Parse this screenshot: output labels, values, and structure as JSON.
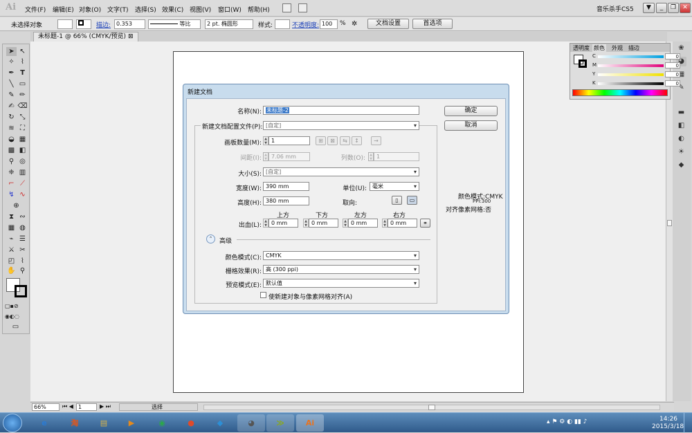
{
  "app": {
    "logo": "Ai",
    "menus": [
      "文件(F)",
      "编辑(E)",
      "对象(O)",
      "文字(T)",
      "选择(S)",
      "效果(C)",
      "视图(V)",
      "窗口(W)",
      "帮助(H)"
    ],
    "brand": "音乐杀手CS5",
    "window_buttons": [
      "▼",
      "_",
      "❐",
      "✕"
    ]
  },
  "control_bar": {
    "selection": "未选择对象",
    "stroke_label": "描边:",
    "stroke_value": "0.353",
    "stroke_style": "等比",
    "brush": "2 pt. 椭圆形",
    "style_label": "样式:",
    "opacity_label": "不透明度:",
    "opacity_value": "100",
    "opacity_unit": "%",
    "doc_setup": "文档设置",
    "preferences": "首选项"
  },
  "document_tab": {
    "label": "未标题-1 @ 66% (CMYK/预览)",
    "close": "⊠"
  },
  "color_panel": {
    "tabs": [
      "透明度",
      "颜色",
      "外观",
      "描边"
    ],
    "channels": [
      {
        "name": "C",
        "value": "0",
        "color": "#00a0e0"
      },
      {
        "name": "M",
        "value": "0",
        "color": "#e0007a"
      },
      {
        "name": "Y",
        "value": "0",
        "color": "#f0e000"
      },
      {
        "name": "K",
        "value": "0",
        "color": "#000000"
      }
    ],
    "unit": "%"
  },
  "dialog": {
    "title": "新建文档",
    "name_label": "名称(N):",
    "name_value": "未标题-2",
    "profile_label": "新建文档配置文件(P):",
    "profile_value": "[自定]",
    "artboards_label": "画板数量(M):",
    "artboards_value": "1",
    "spacing_label": "间距(I):",
    "spacing_value": "7.06 mm",
    "columns_label": "列数(O):",
    "columns_value": "1",
    "size_label": "大小(S):",
    "size_value": "[自定]",
    "width_label": "宽度(W):",
    "width_value": "390 mm",
    "units_label": "单位(U):",
    "units_value": "毫米",
    "height_label": "高度(H):",
    "height_value": "380 mm",
    "orientation_label": "取向:",
    "bleed_label": "出血(L):",
    "bleed_headers": [
      "上方",
      "下方",
      "左方",
      "右方"
    ],
    "bleed_values": [
      "0 mm",
      "0 mm",
      "0 mm",
      "0 mm"
    ],
    "advanced_label": "高级",
    "color_mode_label": "颜色模式(C):",
    "color_mode_value": "CMYK",
    "raster_label": "栅格效果(R):",
    "raster_value": "高 (300 ppi)",
    "preview_label": "预览模式(E):",
    "preview_value": "默认值",
    "align_checkbox": "使新建对象与像素网格对齐(A)",
    "ok": "确定",
    "cancel": "取消",
    "info_color_mode": "颜色模式:CMYK",
    "info_ppi": "PPI:300",
    "info_align": "对齐像素网格:否"
  },
  "status_bar": {
    "zoom": "66%",
    "page": "1",
    "tool": "选择"
  },
  "taskbar": {
    "apps": [
      {
        "label": "e",
        "color": "#2a7bd4"
      },
      {
        "label": "淘",
        "color": "#e2561a"
      },
      {
        "label": "▤",
        "color": "#d6b24a"
      },
      {
        "label": "▶",
        "color": "#e58a1c"
      },
      {
        "label": "◉",
        "color": "#2ba84a"
      },
      {
        "label": "●",
        "color": "#e04a2a"
      },
      {
        "label": "◆",
        "color": "#2c8fd6"
      },
      {
        "label": "◕",
        "color": "#555555"
      },
      {
        "label": "≫",
        "color": "#8aa81c"
      },
      {
        "label": "Ai",
        "color": "#e8731f"
      }
    ],
    "time": "14:26",
    "date": "2015/3/18"
  }
}
